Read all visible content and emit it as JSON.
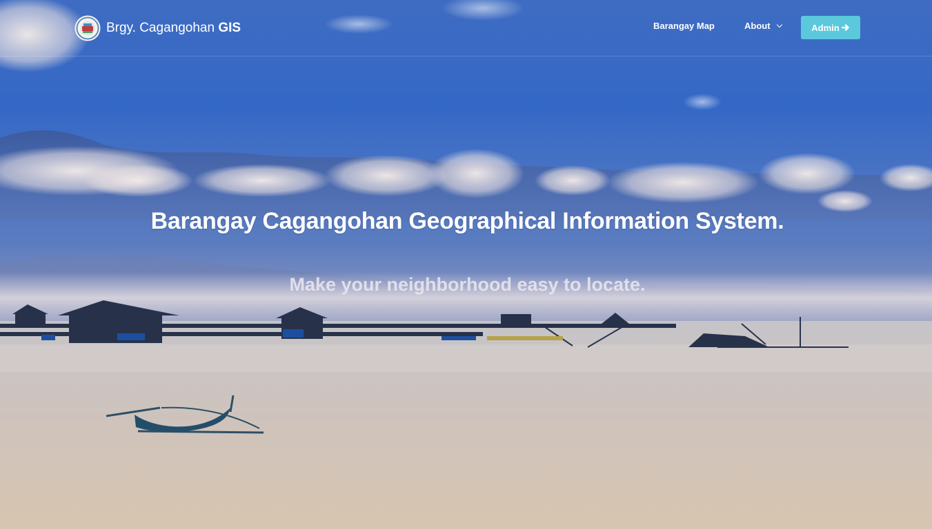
{
  "brand": {
    "name_regular": "Brgy. Cagangohan",
    "name_bold": "GIS",
    "logo_icon": "barangay-seal-icon"
  },
  "nav": {
    "barangay_map": "Barangay Map",
    "about": "About",
    "admin": "Admin"
  },
  "hero": {
    "title": "Barangay Cagangohan Geographical Information System.",
    "subtitle": "Make your neighborhood easy to locate."
  },
  "colors": {
    "admin_button": "#5bc8dc",
    "sky": "#3468c6",
    "water": "#d4c6b4"
  }
}
